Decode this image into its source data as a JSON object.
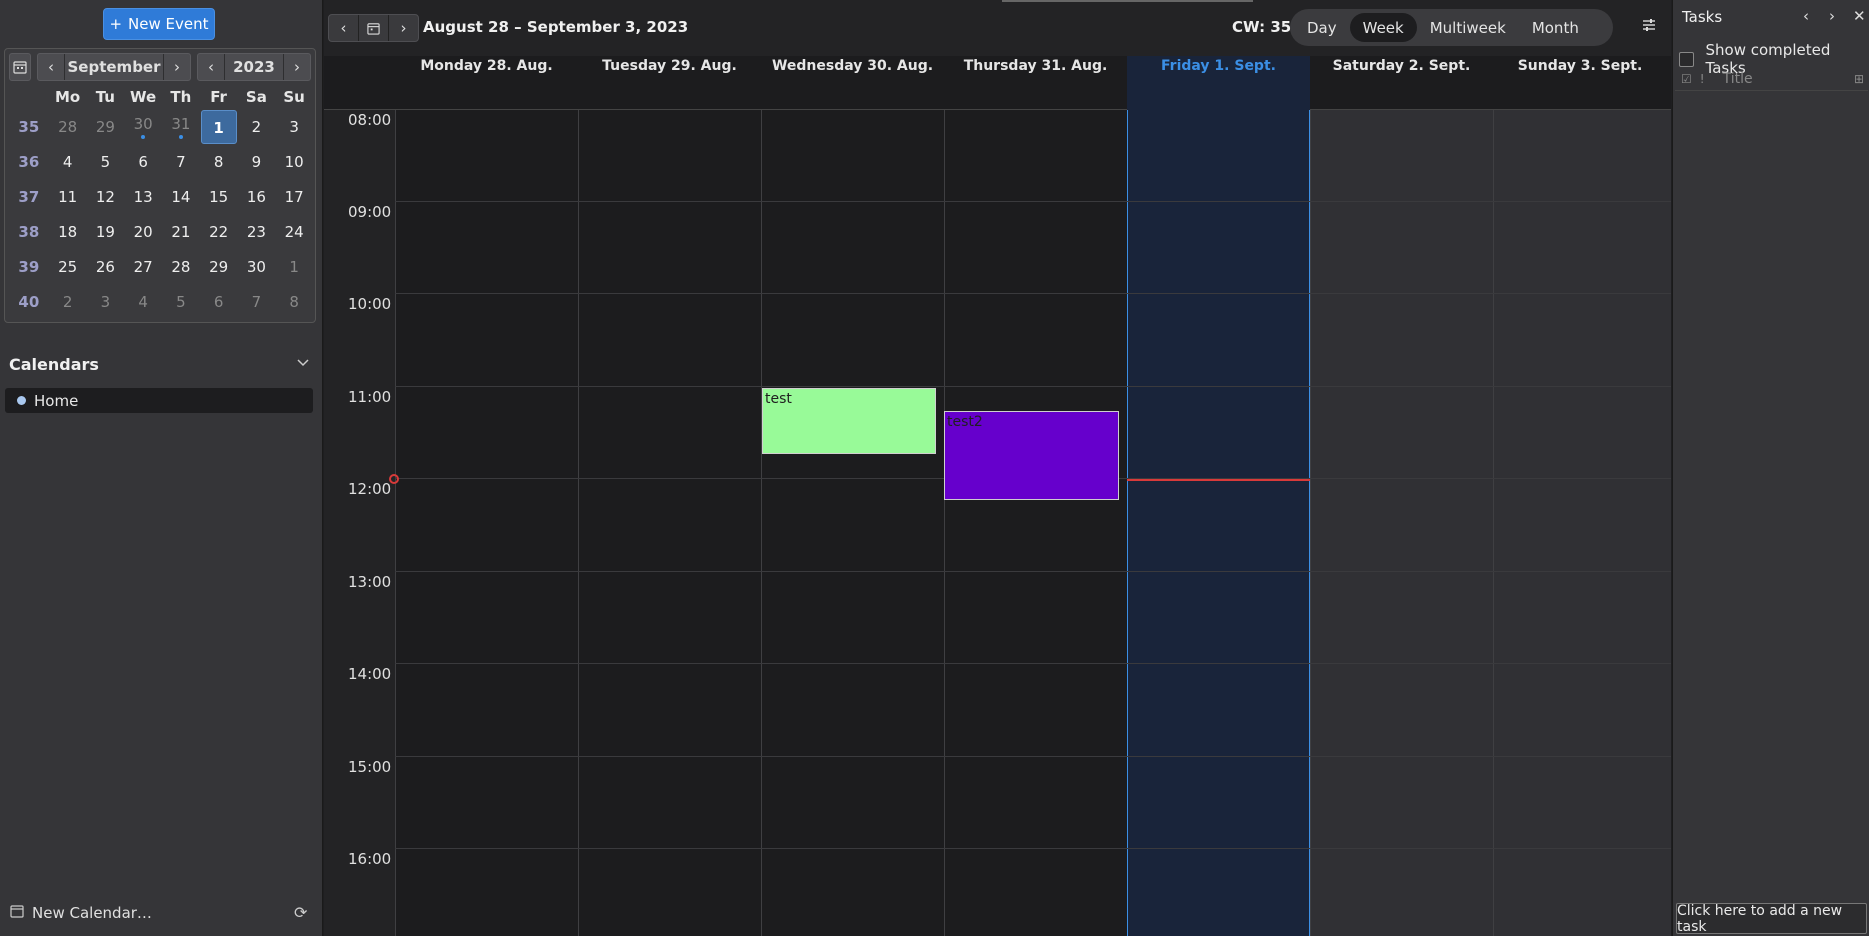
{
  "sidebar": {
    "new_event_label": "New Event",
    "mini_calendar": {
      "month": "September",
      "year": "2023",
      "weekdays": [
        "Mo",
        "Tu",
        "We",
        "Th",
        "Fr",
        "Sa",
        "Su"
      ],
      "weeks": [
        {
          "wk": "35",
          "days": [
            "28",
            "29",
            "30",
            "31",
            "1",
            "2",
            "3"
          ]
        },
        {
          "wk": "36",
          "days": [
            "4",
            "5",
            "6",
            "7",
            "8",
            "9",
            "10"
          ]
        },
        {
          "wk": "37",
          "days": [
            "11",
            "12",
            "13",
            "14",
            "15",
            "16",
            "17"
          ]
        },
        {
          "wk": "38",
          "days": [
            "18",
            "19",
            "20",
            "21",
            "22",
            "23",
            "24"
          ]
        },
        {
          "wk": "39",
          "days": [
            "25",
            "26",
            "27",
            "28",
            "29",
            "30",
            "1"
          ]
        },
        {
          "wk": "40",
          "days": [
            "2",
            "3",
            "4",
            "5",
            "6",
            "7",
            "8"
          ]
        }
      ]
    },
    "calendars_title": "Calendars",
    "calendar_items": [
      {
        "label": "Home",
        "color": "#a9c8ef"
      }
    ],
    "new_calendar_label": "New Calendar…"
  },
  "toolbar": {
    "date_range": "August 28 – September 3, 2023",
    "calendar_week": "CW: 35",
    "views": [
      "Day",
      "Week",
      "Multiweek",
      "Month"
    ],
    "active_view": "Week"
  },
  "week": {
    "days": [
      "Monday 28. Aug.",
      "Tuesday 29. Aug.",
      "Wednesday 30. Aug.",
      "Thursday 31. Aug.",
      "Friday 1. Sept.",
      "Saturday 2. Sept.",
      "Sunday 3. Sept."
    ],
    "today": "Friday 1. Sept.",
    "hours": [
      "08:00",
      "09:00",
      "10:00",
      "11:00",
      "12:00",
      "13:00",
      "14:00",
      "15:00",
      "16:00"
    ],
    "events": [
      {
        "title": "test",
        "day": "Wednesday 30. Aug.",
        "color": "#98fa98"
      },
      {
        "title": "test2",
        "day": "Thursday 31. Aug.",
        "color": "#6600cc"
      }
    ]
  },
  "tasks": {
    "title": "Tasks",
    "show_completed_label": "Show completed Tasks",
    "column_title": "Title",
    "add_task_label": "Click here to add a new task"
  },
  "colors": {
    "accent": "#3b8fe5",
    "now_line": "#d83a3a"
  }
}
